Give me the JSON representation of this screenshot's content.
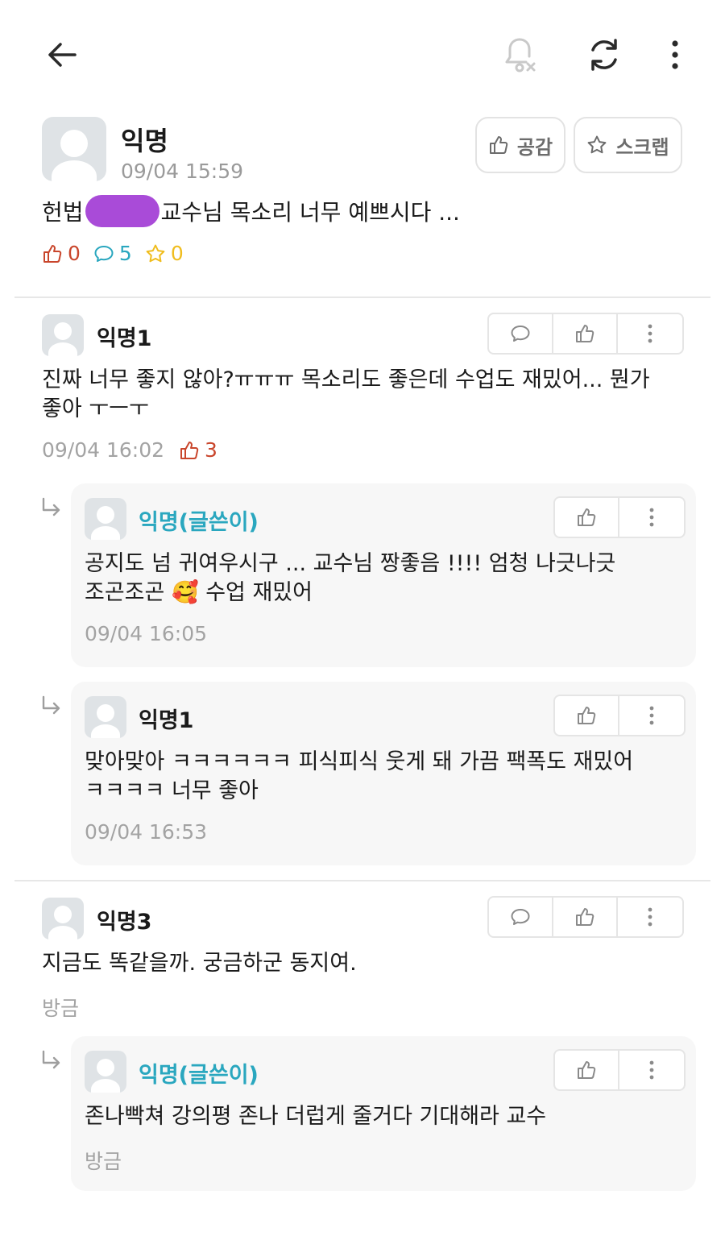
{
  "topbar": {
    "back_icon": "arrow-left-icon",
    "bell_icon": "bell-off-icon",
    "refresh_icon": "refresh-icon",
    "more_icon": "more-vertical-icon"
  },
  "post": {
    "author": "익명",
    "time": "09/04 15:59",
    "body_prefix": "헌법",
    "body_suffix": "교수님 목소리 너무 예쁘시다 ...",
    "like_button": "공감",
    "scrap_button": "스크랩",
    "likes": "0",
    "comments": "5",
    "scraps": "0"
  },
  "comments": [
    {
      "author": "익명1",
      "text_line1": "진짜 너무 좋지 않아?ㅠㅠㅠ 목소리도 좋은데 수업도 재밌어... 뭔가",
      "text_line2": "좋아 ㅜㅡㅜ",
      "time": "09/04 16:02",
      "votes": "3",
      "replies": [
        {
          "author": "익명(글쓴이)",
          "text_line1": "공지도 넘 귀여우시구 ... 교수님 짱좋음 !!!! 엄청 나긋나긋",
          "text_line2a": "조곤조곤",
          "emoji": "🥰",
          "text_line2b": "수업 재밌어",
          "time": "09/04 16:05"
        },
        {
          "author": "익명1",
          "text_line1": "맞아맞아 ㅋㅋㅋㅋㅋㅋ 피식피식 웃게 돼 가끔 팩폭도 재밌어",
          "text_line2": "ㅋㅋㅋㅋ 너무 좋아",
          "time": "09/04 16:53"
        }
      ]
    },
    {
      "author": "익명3",
      "text_line1": "지금도 똑같을까. 궁금하군 동지여.",
      "time": "방금",
      "replies": [
        {
          "author": "익명(글쓴이)",
          "text_line1": "존나빡쳐 강의평 존나 더럽게 줄거다 기대해라 교수",
          "time": "방금"
        }
      ]
    }
  ],
  "colors": {
    "author_accent": "#2aa7bf",
    "like_red": "#c9462c",
    "scrap_yellow": "#f0bd1e",
    "redaction": "#a94bd8"
  }
}
